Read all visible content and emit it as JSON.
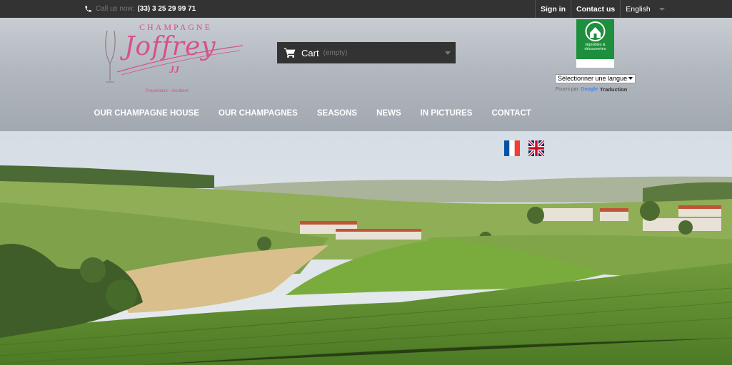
{
  "topbar": {
    "call_label": "Call us now:",
    "phone_number": "(33) 3 25 29 99 71",
    "sign_in": "Sign in",
    "contact_us": "Contact us",
    "language": "English"
  },
  "logo": {
    "top": "CHAMPAGNE",
    "main": "Joffrey",
    "initials": "JJ",
    "subtitle": "Propriétaire - récoltant"
  },
  "cart": {
    "label": "Cart",
    "status": "(empty)"
  },
  "badge": {
    "text": "vignobles & découvertes"
  },
  "translate": {
    "select_label": "Sélectionner une langue",
    "powered_by": "Fourni par",
    "google": "Google",
    "translation": "Traduction"
  },
  "nav": {
    "items": [
      "OUR CHAMPAGNE HOUSE",
      "OUR CHAMPAGNES",
      "SEASONS",
      "NEWS",
      "IN PICTURES",
      "CONTACT"
    ]
  },
  "icons": {
    "phone": "phone-icon",
    "cart": "cart-icon",
    "french_flag": "french-flag-icon",
    "uk_flag": "uk-flag-icon"
  },
  "colors": {
    "topbar": "#333333",
    "accent_pink": "#d6528a",
    "badge_green": "#1e8f3c"
  }
}
